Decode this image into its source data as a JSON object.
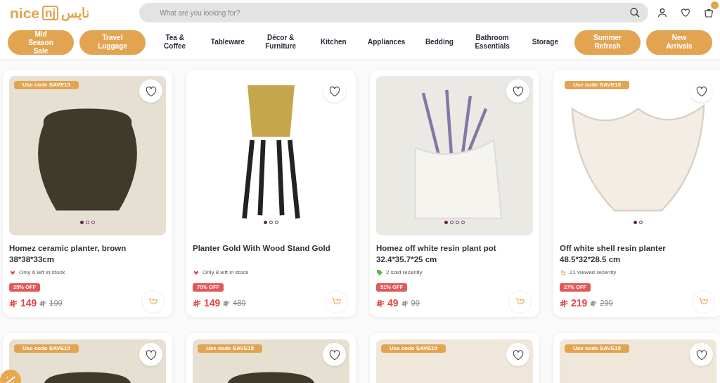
{
  "header": {
    "logo": {
      "latin": "nice",
      "boxed": "nj",
      "arabic": "نايس"
    },
    "search": {
      "placeholder": "What are you looking for?"
    }
  },
  "nav": [
    {
      "label": "Mid Season Sale",
      "kind": "pill"
    },
    {
      "label": "Travel Luggage",
      "kind": "pill"
    },
    {
      "label": "Tea & Coffee",
      "kind": "plain"
    },
    {
      "label": "Tableware",
      "kind": "plain"
    },
    {
      "label": "Décor & Furniture",
      "kind": "plain"
    },
    {
      "label": "Kitchen",
      "kind": "plain"
    },
    {
      "label": "Appliances",
      "kind": "plain"
    },
    {
      "label": "Bedding",
      "kind": "plain"
    },
    {
      "label": "Bathroom Essentials",
      "kind": "plain"
    },
    {
      "label": "Storage",
      "kind": "plain"
    },
    {
      "label": "Summer Refresh",
      "kind": "pill"
    },
    {
      "label": "New Arrivals",
      "kind": "pill"
    }
  ],
  "products": [
    {
      "code": "Use code SAVE15",
      "slides": [
        {
          "selected": true
        },
        {
          "selected": false
        },
        {
          "selected": false
        }
      ],
      "title": "Homez ceramic planter, brown 38*38*33cm",
      "note": {
        "kind": "stock",
        "text": "Only 6 left in stock"
      },
      "discount": "25% OFF",
      "price": "149",
      "old_price": "199"
    },
    {
      "slides": [
        {
          "selected": true
        },
        {
          "selected": false
        },
        {
          "selected": false
        }
      ],
      "title": "Planter Gold With Wood Stand Gold",
      "note": {
        "kind": "stock",
        "text": "Only 8 left in stock"
      },
      "discount": "70% OFF",
      "price": "149",
      "old_price": "489"
    },
    {
      "slides": [
        {
          "selected": true
        },
        {
          "selected": false
        },
        {
          "selected": false
        },
        {
          "selected": false
        }
      ],
      "title": "Homez off white resin plant pot 32.4*35.7*25 cm",
      "note": {
        "kind": "sold",
        "text": "2 sold recently"
      },
      "discount": "51% OFF",
      "price": "49",
      "old_price": "99"
    },
    {
      "code": "Use code SAVE15",
      "slides": [
        {
          "selected": true
        },
        {
          "selected": false
        }
      ],
      "title": "Off white shell resin planter 48.5*32*28.5 cm",
      "note": {
        "kind": "viewed",
        "text": "21 viewed recently"
      },
      "discount": "27% OFF",
      "price": "219",
      "old_price": "299"
    },
    {
      "code": "Use code SAVE15"
    },
    {
      "code": "Use code SAVE15"
    },
    {
      "code": "Use code SAVE15"
    },
    {
      "code": "Use code SAVE15"
    }
  ]
}
